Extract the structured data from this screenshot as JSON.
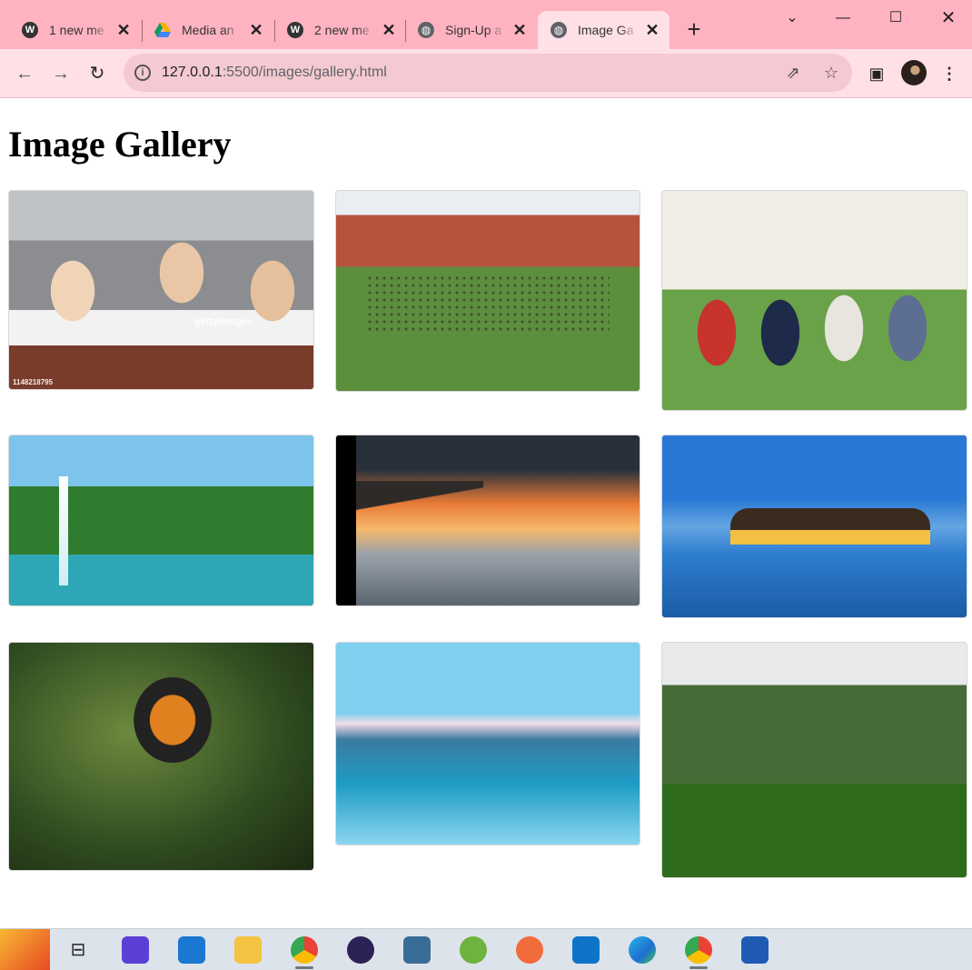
{
  "browser": {
    "tabs": [
      {
        "title": "1 new me",
        "icon": "wordpress-icon"
      },
      {
        "title": "Media an",
        "icon": "google-drive-icon"
      },
      {
        "title": "2 new me",
        "icon": "wordpress-icon"
      },
      {
        "title": "Sign-Up a",
        "icon": "globe-icon"
      },
      {
        "title": "Image Ga",
        "icon": "globe-icon",
        "active": true
      }
    ],
    "url_host": "127.0.0.1",
    "url_path": ":5500/images/gallery.html"
  },
  "page": {
    "title": "Image Gallery",
    "images": [
      {
        "subject": "students",
        "watermark": "gettyimages",
        "id_text": "1148218795"
      },
      {
        "subject": "campus"
      },
      {
        "subject": "college"
      },
      {
        "subject": "waterfall"
      },
      {
        "subject": "pier"
      },
      {
        "subject": "villa"
      },
      {
        "subject": "butterfly"
      },
      {
        "subject": "falls"
      },
      {
        "subject": "forest"
      }
    ]
  },
  "taskbar": {
    "apps": [
      "news-widget-icon",
      "task-view-icon",
      "vs-icon",
      "mail-icon",
      "file-explorer-icon",
      "chrome-icon",
      "eclipse-icon",
      "mysql-icon",
      "spring-icon",
      "postman-icon",
      "vscode-icon",
      "edge-icon",
      "chrome-icon",
      "word-icon"
    ]
  },
  "colors": {
    "tabbar": "#ffb3c1",
    "toolbar": "#ffe0e6"
  }
}
